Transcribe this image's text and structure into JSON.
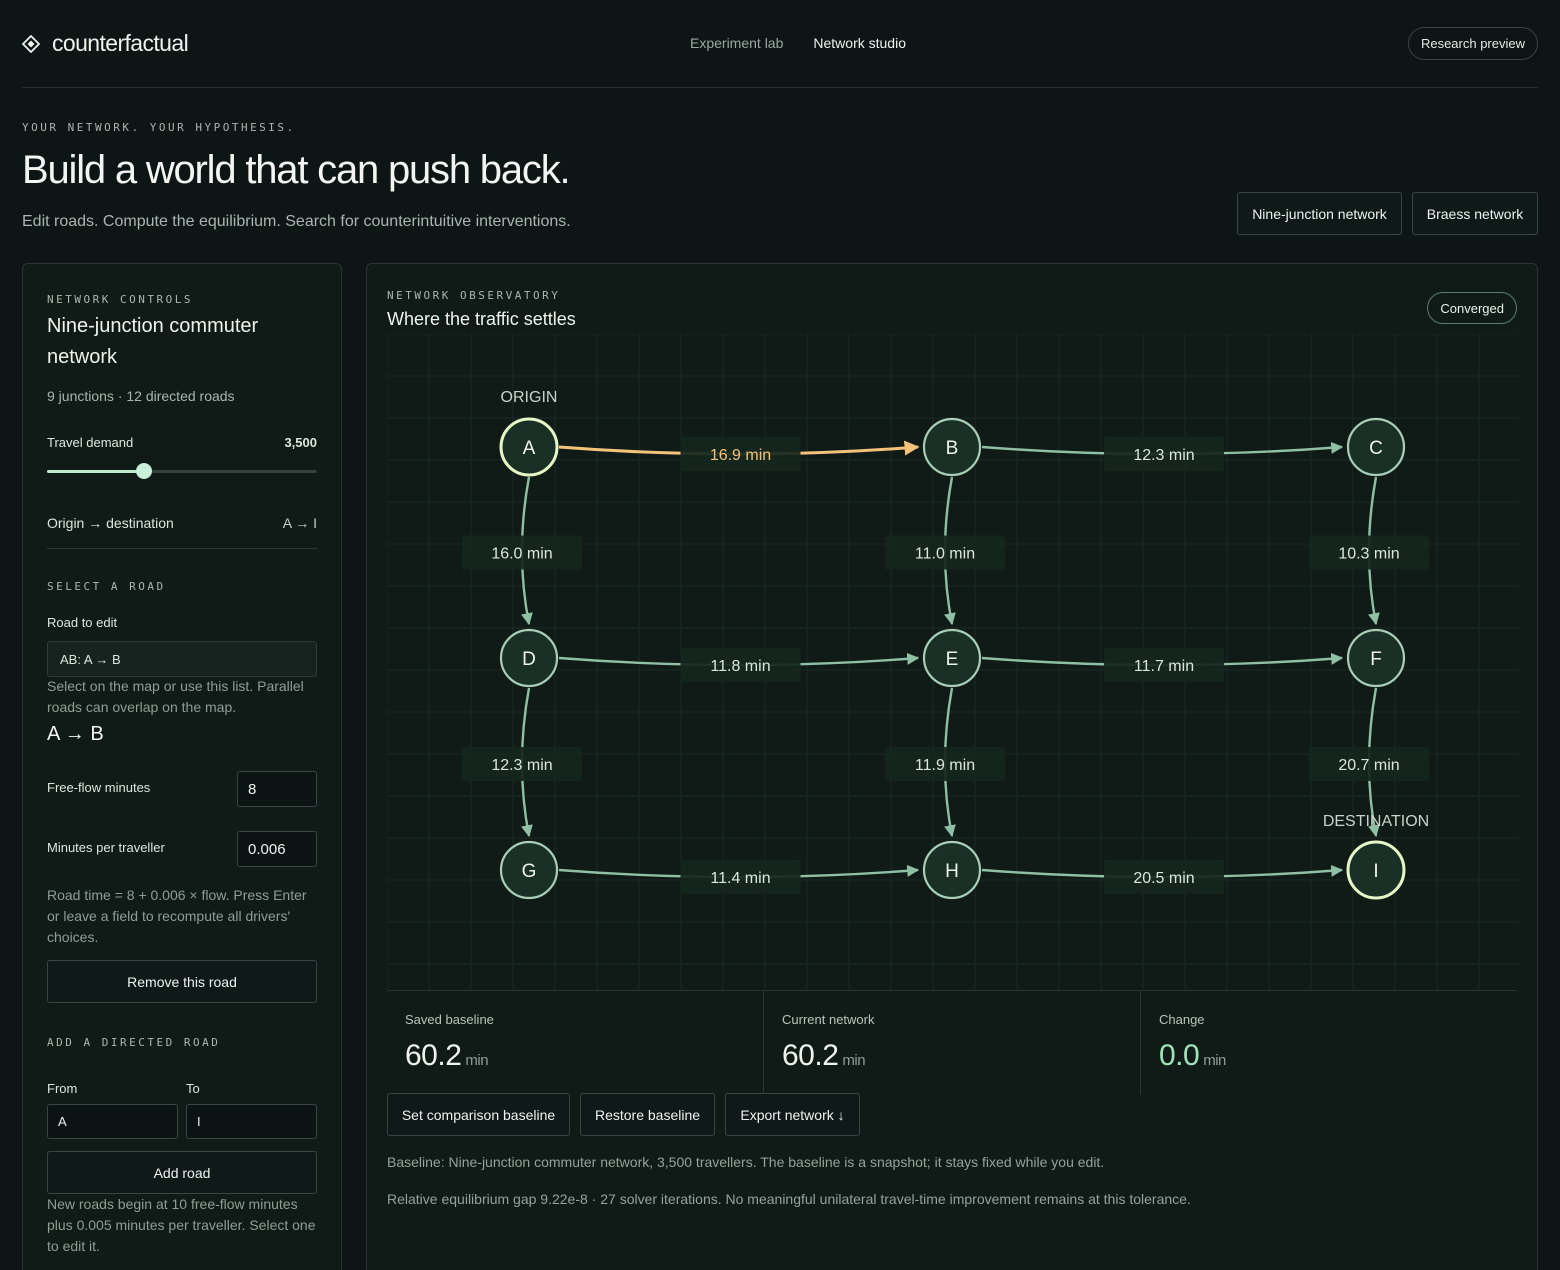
{
  "header": {
    "brand": "counterfactual",
    "nav": [
      {
        "label": "Experiment lab",
        "active": false
      },
      {
        "label": "Network studio",
        "active": true
      }
    ],
    "preview_label": "Research preview"
  },
  "hero": {
    "eyebrow": "YOUR NETWORK. YOUR HYPOTHESIS.",
    "title": "Build a world that can push back.",
    "subtitle": "Edit roads. Compute the equilibrium. Search for counterintuitive interventions.",
    "presets": [
      "Nine-junction network",
      "Braess network"
    ]
  },
  "controls": {
    "eyebrow": "NETWORK CONTROLS",
    "title": "Nine-junction commuter network",
    "summary": "9 junctions · 12 directed roads",
    "demand_label": "Travel demand",
    "demand_value": "3,500",
    "demand_fraction": 0.36,
    "od_label": "Origin → destination",
    "od_value": "A → I",
    "select_eyebrow": "SELECT A ROAD",
    "road_label": "Road to edit",
    "road_selected": "AB: A → B",
    "road_help": "Select on the map or use this list. Parallel roads can overlap on the map.",
    "road_heading": "A → B",
    "freeflow_label": "Free-flow minutes",
    "freeflow_value": "8",
    "mpt_label": "Minutes per traveller",
    "mpt_value": "0.006",
    "formula_note": "Road time = 8 + 0.006 × flow. Press Enter or leave a field to recompute all drivers' choices.",
    "remove_label": "Remove this road",
    "add_eyebrow": "ADD A DIRECTED ROAD",
    "from_label": "From",
    "to_label": "To",
    "from_value": "A",
    "to_value": "I",
    "add_label": "Add road",
    "add_note": "New roads begin at 10 free-flow minutes plus 0.005 minutes per traveller. Select one to edit it."
  },
  "observatory": {
    "eyebrow": "NETWORK OBSERVATORY",
    "title": "Where the traffic settles",
    "status": "Converged",
    "origin_label": "ORIGIN",
    "destination_label": "DESTINATION",
    "nodes": [
      "A",
      "B",
      "C",
      "D",
      "E",
      "F",
      "G",
      "H",
      "I"
    ],
    "edges": [
      {
        "from": "A",
        "to": "B",
        "label": "16.9 min",
        "selected": true
      },
      {
        "from": "B",
        "to": "C",
        "label": "12.3 min"
      },
      {
        "from": "A",
        "to": "D",
        "label": "16.0 min"
      },
      {
        "from": "B",
        "to": "E",
        "label": "11.0 min"
      },
      {
        "from": "C",
        "to": "F",
        "label": "10.3 min"
      },
      {
        "from": "D",
        "to": "E",
        "label": "11.8 min"
      },
      {
        "from": "E",
        "to": "F",
        "label": "11.7 min"
      },
      {
        "from": "D",
        "to": "G",
        "label": "12.3 min"
      },
      {
        "from": "E",
        "to": "H",
        "label": "11.9 min"
      },
      {
        "from": "F",
        "to": "I",
        "label": "20.7 min"
      },
      {
        "from": "G",
        "to": "H",
        "label": "11.4 min"
      },
      {
        "from": "H",
        "to": "I",
        "label": "20.5 min"
      }
    ],
    "stats": [
      {
        "label": "Saved baseline",
        "value": "60.2",
        "unit": "min"
      },
      {
        "label": "Current network",
        "value": "60.2",
        "unit": "min"
      },
      {
        "label": "Change",
        "value": "0.0",
        "unit": "min"
      }
    ],
    "actions": [
      "Set comparison baseline",
      "Restore baseline",
      "Export network ↓"
    ],
    "baseline_note": "Baseline: Nine-junction commuter network, 3,500 travellers. The baseline is a snapshot; it stays fixed while you edit.",
    "gap_note": "Relative equilibrium gap 9.22e-8 · 27 solver iterations. No meaningful unilateral travel-time improvement remains at this tolerance."
  },
  "colors": {
    "accent": "#bfe9cf",
    "selected_road": "#f5c27a",
    "road": "#8fbfa4",
    "change_value": "#9fe3b9"
  }
}
